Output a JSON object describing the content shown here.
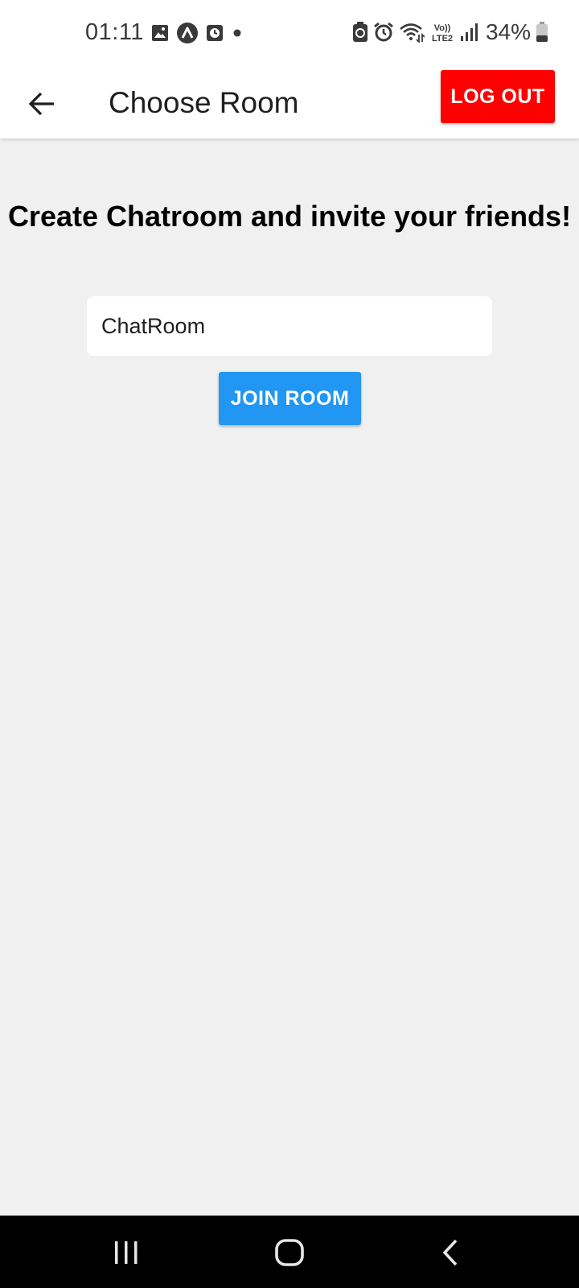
{
  "status_bar": {
    "time": "01:11",
    "battery": "34%",
    "left_icons": [
      "image-icon",
      "app-icon",
      "clock-icon",
      "dot-icon"
    ],
    "right_icons": [
      "battery-saver-icon",
      "alarm-icon",
      "wifi-icon",
      "volte-icon",
      "signal-icon",
      "battery-icon"
    ],
    "volte_label_top": "Vo))",
    "volte_label_bottom": "LTE2"
  },
  "app_bar": {
    "title": "Choose Room",
    "logout_label": "LOG OUT",
    "logout_color": "#ff0000"
  },
  "main": {
    "headline": "Create Chatroom and invite your friends!",
    "room_input_value": "ChatRoom",
    "join_label": "JOIN ROOM",
    "join_color": "#2196f3"
  },
  "nav_bar": {
    "buttons": [
      "recents-icon",
      "home-icon",
      "back-icon"
    ]
  }
}
